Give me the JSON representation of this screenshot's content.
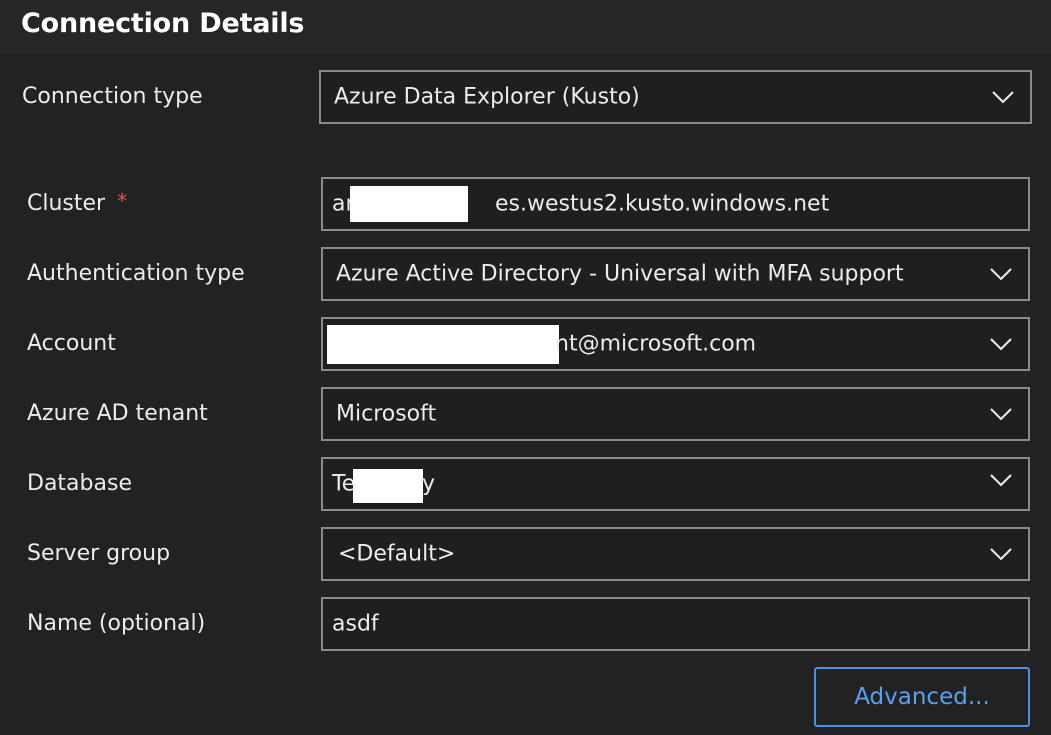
{
  "header": {
    "title": "Connection Details"
  },
  "fields": {
    "connection_type": {
      "label": "Connection type",
      "value": "Azure Data Explorer (Kusto)"
    },
    "cluster": {
      "label": "Cluster",
      "required_mark": "*",
      "value_prefix": "ar",
      "value_suffix": "es.westus2.kusto.windows.net"
    },
    "authentication_type": {
      "label": "Authentication type",
      "value": "Azure Active Directory - Universal with MFA support"
    },
    "account": {
      "label": "Account",
      "value_suffix": "nt@microsoft.com"
    },
    "tenant": {
      "label": "Azure AD tenant",
      "value": "Microsoft"
    },
    "database": {
      "label": "Database",
      "value_prefix": "Te",
      "value_suffix": "y"
    },
    "server_group": {
      "label": "Server group",
      "value": "<Default>"
    },
    "name": {
      "label": "Name (optional)",
      "value": "asdf"
    }
  },
  "buttons": {
    "advanced": "Advanced..."
  },
  "colors": {
    "background": "#222222",
    "header_background": "#262626",
    "field_border": "#8a8a8a",
    "accent": "#4a90e2",
    "required": "#e0564f"
  },
  "icons": {
    "dropdown": "chevron-down-icon"
  }
}
